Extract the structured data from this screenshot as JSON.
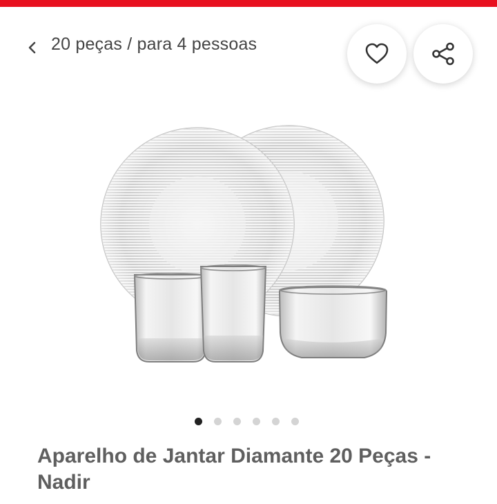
{
  "header": {
    "back_icon": "chevron-left-icon",
    "breadcrumb": "20 peças / para 4 pessoas",
    "favorite_icon": "heart-icon",
    "share_icon": "share-icon"
  },
  "gallery": {
    "image_description_icon": "product-photo",
    "total_images": 6,
    "active_index": 0
  },
  "product": {
    "title": "Aparelho de Jantar Diamante 20 Peças - Nadir"
  },
  "colors": {
    "brand_red": "#e8101f",
    "active_dot": "#222222",
    "inactive_dot": "#d4d4d4",
    "title_text": "#5f5f5f"
  }
}
